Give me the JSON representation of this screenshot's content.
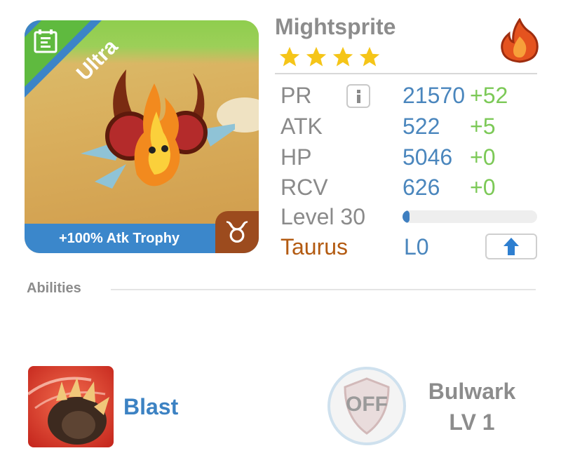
{
  "monster": {
    "name": "Mightsprite",
    "rarity": "Ultra",
    "star_count": 4,
    "element_icon": "fire-icon",
    "trophy": "+100% Atk Trophy",
    "zodiac_symbol": "♉",
    "zodiac_icon": "taurus-icon",
    "collection_icon": "calendar-icon"
  },
  "stats": [
    {
      "label": "PR",
      "value": "21570",
      "delta": "+52"
    },
    {
      "label": "ATK",
      "value": "522",
      "delta": "+5"
    },
    {
      "label": "HP",
      "value": "5046",
      "delta": "+0"
    },
    {
      "label": "RCV",
      "value": "626",
      "delta": "+0"
    }
  ],
  "info_icon": "info-icon",
  "level": {
    "label": "Level 30",
    "progress_fraction": 0.05
  },
  "constellation": {
    "name": "Taurus",
    "value": "L0",
    "upgrade_icon": "arrow-up-icon"
  },
  "abilities": {
    "title": "Abilities",
    "primary": {
      "name": "Blast",
      "icon": "claw-icon"
    },
    "secondary": {
      "badge": "OFF",
      "name": "Bulwark",
      "level": "LV 1",
      "icon": "shield-icon"
    }
  },
  "colors": {
    "accent_blue": "#3c82c3",
    "stat_green": "#7cc957",
    "constellation_brown": "#b35b12",
    "ribbon_green": "#5fba3f",
    "fire_orange": "#e5531f"
  }
}
